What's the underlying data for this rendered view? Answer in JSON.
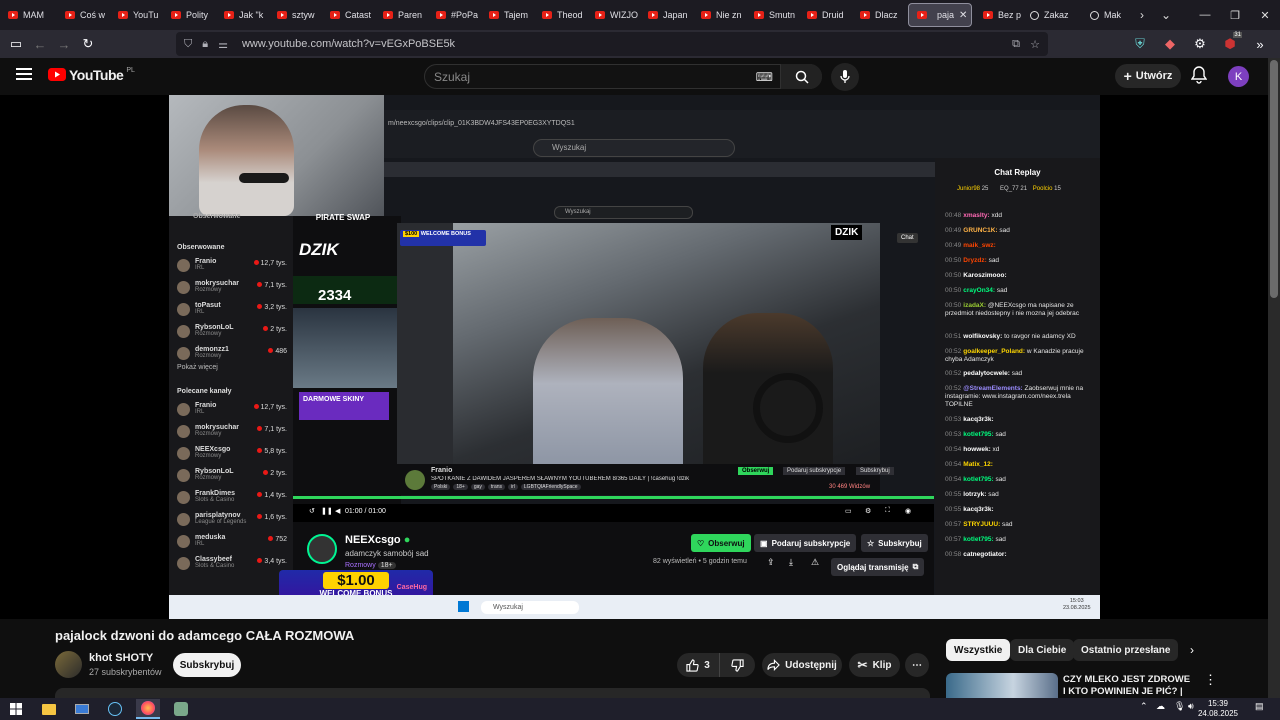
{
  "browser": {
    "tabs": [
      "MAM",
      "Coś w",
      "YouTu",
      "Polity",
      "Jak \"k",
      "sztyw",
      "Catast",
      "Paren",
      "#PoPa",
      "Tajem",
      "Theod",
      "WIZJO",
      "Japan",
      "Nie zn",
      "Smutn",
      "Druid",
      "Dlacz"
    ],
    "active_tab": "paja",
    "tabs_after": [
      "Bez p",
      "Zakaz",
      "Mak"
    ],
    "url": "www.youtube.com/watch?v=vEGxPoBSE5k",
    "ext_badge": "31"
  },
  "youtube": {
    "logo": "YouTube",
    "region": "PL",
    "search_placeholder": "Szukaj",
    "create_label": "Utwórz",
    "avatar_letter": "K"
  },
  "inner": {
    "url": "m/neexcsgo/clips/clip_01K3BDW4JFS43EP0EG3XYTDQS1",
    "search_placeholder": "Wyszukaj",
    "search_placeholder2": "Wyszukaj",
    "sidebar_followed_title": "Obserwowane",
    "sidebar_followed_head": "Obserwowane",
    "followed": [
      {
        "name": "Franio",
        "cat": "IRL",
        "count": "12,7 tys."
      },
      {
        "name": "mokrysuchar",
        "cat": "Rozmowy",
        "count": "7,1 tys."
      },
      {
        "name": "toPasut",
        "cat": "IRL",
        "count": "3,2 tys."
      },
      {
        "name": "RybsonLoL",
        "cat": "Rozmowy",
        "count": "2 tys."
      },
      {
        "name": "demonzz1",
        "cat": "Rozmowy",
        "count": "486"
      }
    ],
    "show_more": "Pokaż więcej",
    "recommended_head": "Polecane kanały",
    "recommended": [
      {
        "name": "Franio",
        "cat": "IRL",
        "count": "12,7 tys."
      },
      {
        "name": "mokrysuchar",
        "cat": "Rozmowy",
        "count": "7,1 tys."
      },
      {
        "name": "NEEXcsgo",
        "cat": "Rozmowy",
        "count": "5,8 tys."
      },
      {
        "name": "RybsonLoL",
        "cat": "Rozmowy",
        "count": "2 tys."
      },
      {
        "name": "FrankDimes",
        "cat": "Slots & Casino",
        "count": "1,4 tys."
      },
      {
        "name": "parisplatynov",
        "cat": "League of Legends",
        "count": "1,6 tys."
      },
      {
        "name": "meduska",
        "cat": "IRL",
        "count": "752"
      },
      {
        "name": "Classybeef",
        "cat": "Slots & Casino",
        "count": "3,4 tys."
      }
    ],
    "mid_brand": "PIRATE SWAP",
    "dzik_left": "DZIK",
    "dzik_right": "DZIK",
    "count_big": "2334",
    "darmowe": "DARMOWE SKINY",
    "stream_welcome": "WELCOME BONUS",
    "stream_amount": "$100",
    "chat_btn": "Chat",
    "stream_streamer": "Franio",
    "stream_title": "SPOTKANIE Z DAWIDEM JASPEREM SŁAWNYM YOUTUBEREM 8/365 DAILY | !casehug !dzik",
    "stream_tags": [
      "Polski",
      "18+",
      "gay",
      "trans",
      "irl",
      "LGBTQIAFriendlySpace"
    ],
    "stream_follow": "Obserwuj",
    "stream_sub": "Podaruj subskrypcje",
    "stream_sub2": "Subskrybuj",
    "stream_viewers": "30 469 Widzów",
    "time_current": "01:00",
    "time_total": "01:00",
    "channel_name": "NEEXcsgo",
    "channel_desc": "adamczyk samobój sad",
    "channel_cat": "Rozmowy",
    "channel_badge": "18+",
    "follow_btn": "Obserwuj",
    "gift_btn": "Podaruj subskrypcje",
    "sub_btn": "Subskrybuj",
    "views": "82 wyświetleń • 5 godzin temu",
    "watch_btn": "Oglądaj transmisję",
    "promo_amount": "$1.00",
    "promo_text": "WELCOME BONUS",
    "promo_brand": "CaseHug",
    "chat_title": "Chat Replay",
    "top_user": "Junior98",
    "top_user_count": "25",
    "top2_user": "EQ_77",
    "top2_count": "21",
    "top3_user": "Poolcio",
    "top3_count": "15",
    "inner_taskbar_search": "Wyszukaj",
    "inner_clock": "15:03",
    "inner_date": "23.08.2025"
  },
  "chat": [
    {
      "t": "00:48",
      "u": "xmaslty",
      "m": "xdd",
      "c": "#ff69b4"
    },
    {
      "t": "00:49",
      "u": "GRUNC1K",
      "m": "sad",
      "c": "#ffb347"
    },
    {
      "t": "00:49",
      "u": "maik_swz",
      "m": "",
      "c": "#ff4500"
    },
    {
      "t": "00:50",
      "u": "Dryzdz",
      "m": "sad",
      "c": "#ff4500"
    },
    {
      "t": "00:50",
      "u": "Karoszimooo",
      "m": "",
      "c": "#ffffff"
    },
    {
      "t": "00:50",
      "u": "crayOn34",
      "m": "sad",
      "c": "#00ff7f"
    },
    {
      "t": "00:50",
      "u": "izadaX",
      "m": "@NEEXcsgo ma napisane ze przedmiot niedostepny i nie mozna jej odebrac",
      "c": "#9acd32"
    },
    {
      "t": "00:51",
      "u": "wolfikovsky",
      "m": "to ravgor nie adamcy XD",
      "c": "#ffffff"
    },
    {
      "t": "00:52",
      "u": "goalkeeper_Poland",
      "m": "w Kanadzie pracuje chyba Adamczyk",
      "c": "#ffd700"
    },
    {
      "t": "00:52",
      "u": "pedalytocwele",
      "m": "sad",
      "c": "#ffffff"
    },
    {
      "t": "00:52",
      "u": "@StreamElements",
      "m": "Zaobserwuj mnie na instagramie: www.instagram.com/neex.trela TOPILNE",
      "c": "#9b8cff"
    },
    {
      "t": "00:53",
      "u": "kacq3r3k",
      "m": "",
      "c": "#ffffff"
    },
    {
      "t": "00:53",
      "u": "kotlet795",
      "m": "sad",
      "c": "#00ff7f"
    },
    {
      "t": "00:54",
      "u": "howwek",
      "m": "xd",
      "c": "#ffffff"
    },
    {
      "t": "00:54",
      "u": "Matix_12",
      "m": "",
      "c": "#ffd700"
    },
    {
      "t": "00:54",
      "u": "kotlet795",
      "m": "sad",
      "c": "#00ff7f"
    },
    {
      "t": "00:55",
      "u": "lotrzyk",
      "m": "sad",
      "c": "#ffffff"
    },
    {
      "t": "00:55",
      "u": "kacq3r3k",
      "m": "",
      "c": "#ffffff"
    },
    {
      "t": "00:57",
      "u": "STRYJUUU",
      "m": "sad",
      "c": "#ffd700"
    },
    {
      "t": "00:57",
      "u": "kotlet795",
      "m": "sad",
      "c": "#00ff7f"
    },
    {
      "t": "00:58",
      "u": "catnegotiator",
      "m": "",
      "c": "#ffffff"
    }
  ],
  "below": {
    "title": "pajalock dzwoni do adamcego CAŁA ROZMOWA",
    "channel": "khot SHOTY",
    "subs": "27 subskrybentów",
    "subscribe": "Subskrybuj",
    "likes": "3",
    "share": "Udostępnij",
    "clip": "Klip"
  },
  "chips": [
    "Wszystkie",
    "Dla Ciebie",
    "Ostatnio przesłane"
  ],
  "rec": {
    "title": "CZY MLEKO JEST ZDROWE I KTO POWINIEN JE PIĆ? |"
  },
  "taskbar": {
    "time": "15:39",
    "date": "24.08.2025"
  },
  "colors": {
    "youtube_red": "#ff0000",
    "twitch_purple": "#9146ff",
    "twitch_green": "#2fd65c",
    "live_red": "#e91916"
  }
}
